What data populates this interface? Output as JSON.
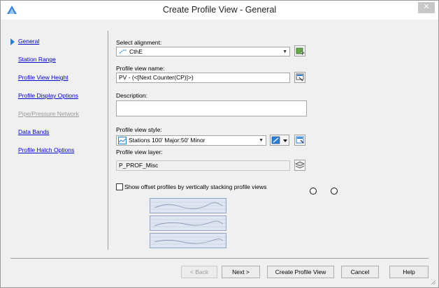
{
  "window": {
    "title": "Create Profile View - General",
    "close_label": "✕"
  },
  "nav": {
    "items": [
      {
        "label": "General",
        "active": true,
        "enabled": true
      },
      {
        "label": "Station Range",
        "active": false,
        "enabled": true
      },
      {
        "label": "Profile View Height",
        "active": false,
        "enabled": true
      },
      {
        "label": "Profile Display Options",
        "active": false,
        "enabled": true
      },
      {
        "label": "Pipe/Pressure Network",
        "active": false,
        "enabled": false
      },
      {
        "label": "Data Bands",
        "active": false,
        "enabled": true
      },
      {
        "label": "Profile Hatch Options",
        "active": false,
        "enabled": true
      }
    ]
  },
  "form": {
    "alignment": {
      "label": "Select alignment:",
      "value": "CthE",
      "icon": "alignment-icon"
    },
    "view_name": {
      "label": "Profile view name:",
      "value": "PV - (<[Next Counter(CP)]>)",
      "icon": "edit-name-icon"
    },
    "description": {
      "label": "Description:",
      "value": ""
    },
    "style": {
      "label": "Profile view style:",
      "value": "Stations 100' Major:50' Minor",
      "icon": "style-icon"
    },
    "layer": {
      "label": "Profile view layer:",
      "value": "P_PROF_Misc",
      "icon": "layer-icon"
    },
    "offset_checkbox": {
      "label": "Show offset profiles by vertically stacking profile views",
      "checked": false
    }
  },
  "buttons": {
    "back": "< Back",
    "next": "Next >",
    "create": "Create Profile View",
    "cancel": "Cancel",
    "help": "Help"
  },
  "colors": {
    "accent": "#2a7fd4",
    "link": "#0000cc",
    "disabled": "#9a9a9a"
  }
}
